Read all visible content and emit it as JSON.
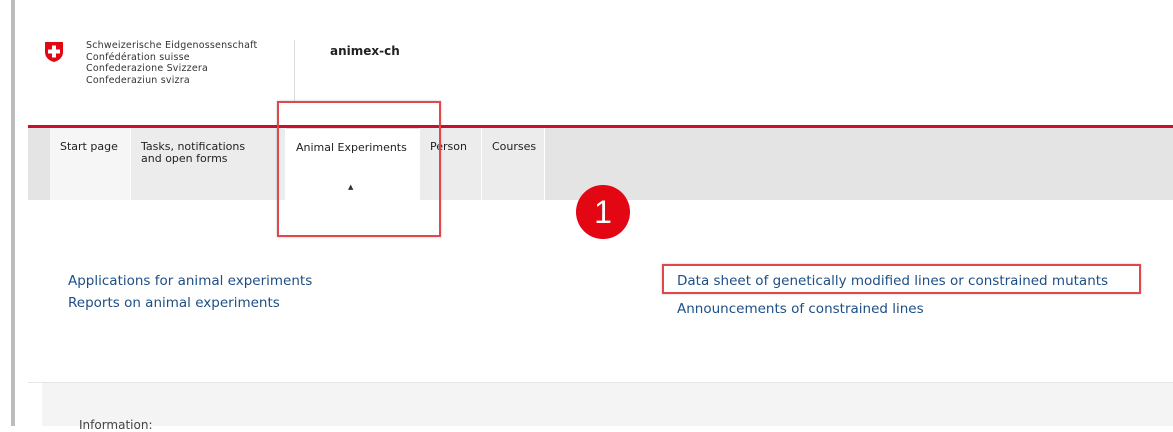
{
  "header": {
    "confederation_names": [
      "Schweizerische Eidgenossenschaft",
      "Confédération suisse",
      "Confederazione Svizzera",
      "Confederaziun svizra"
    ],
    "app_name": "animex-ch"
  },
  "nav": {
    "tabs": [
      {
        "label": "Start page"
      },
      {
        "label_line1": "Tasks, notifications",
        "label_line2": "and open forms"
      },
      {
        "label": "Animal Experiments",
        "active": true
      },
      {
        "label": "Person"
      },
      {
        "label": "Courses"
      }
    ]
  },
  "main": {
    "links_left": [
      "Applications for animal experiments",
      "Reports on animal experiments"
    ],
    "links_right": [
      "Data sheet of genetically modified lines or constrained mutants",
      "Announcements of constrained lines"
    ]
  },
  "info": {
    "label": "Information:"
  },
  "annotation": {
    "step_number": "1",
    "color": "#e30613"
  },
  "colors": {
    "brand_red": "#c8102e",
    "link": "#1d4e85",
    "highlight": "#e0494c"
  }
}
